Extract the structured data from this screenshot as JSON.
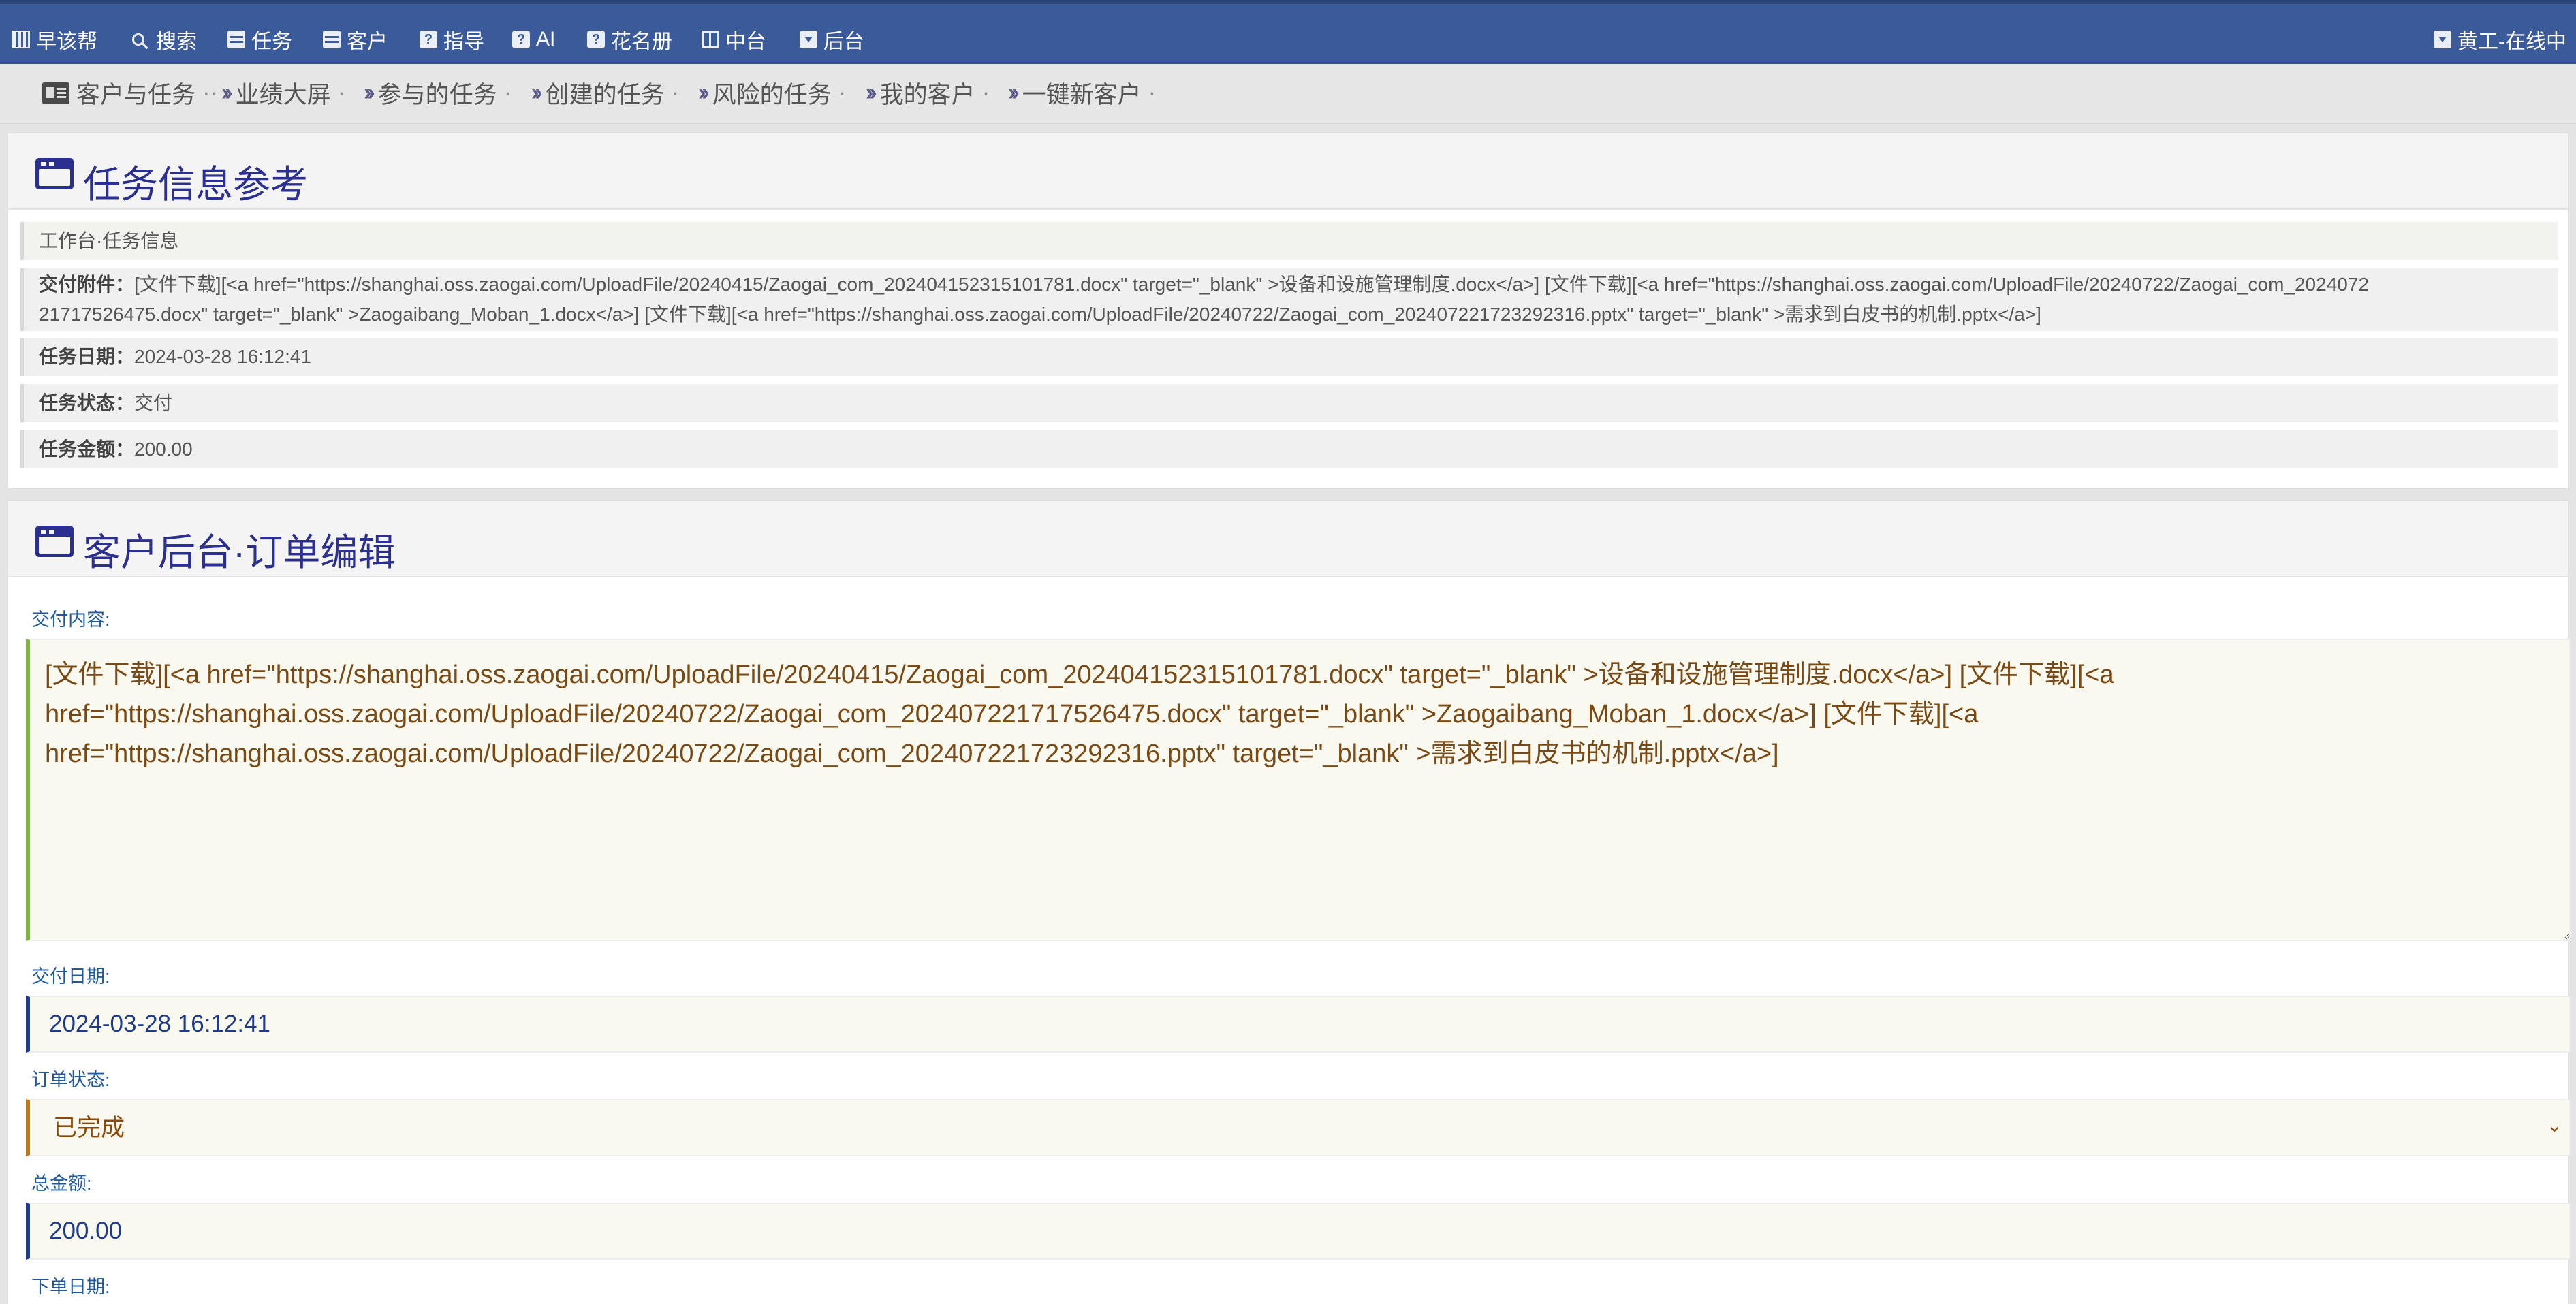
{
  "nav": {
    "items": [
      {
        "label": "早该帮",
        "icon": "barcode-icon"
      },
      {
        "label": "搜索",
        "icon": "search-icon"
      },
      {
        "label": "任务",
        "icon": "card-icon"
      },
      {
        "label": "客户",
        "icon": "card-icon"
      },
      {
        "label": "指导",
        "icon": "question-icon"
      },
      {
        "label": "AI",
        "icon": "question-icon"
      },
      {
        "label": "花名册",
        "icon": "question-icon"
      },
      {
        "label": "中台",
        "icon": "book-icon"
      },
      {
        "label": "后台",
        "icon": "dropdown-icon"
      }
    ],
    "user": "黄工-在线中"
  },
  "breadcrumb": {
    "home": "客户与任务",
    "home_sep": "··",
    "items": [
      {
        "label": "业绩大屏",
        "sep": "·"
      },
      {
        "label": "参与的任务",
        "sep": "·"
      },
      {
        "label": "创建的任务",
        "sep": "·"
      },
      {
        "label": "风险的任务",
        "sep": "·"
      },
      {
        "label": "我的客户",
        "sep": "·"
      },
      {
        "label": "一键新客户",
        "sep": "·"
      }
    ]
  },
  "task_info": {
    "title": "任务信息参考",
    "section": "工作台·任务信息",
    "attachments_label": "交付附件：",
    "attachments_line1": "[文件下载][<a href=\"https://shanghai.oss.zaogai.com/UploadFile/20240415/Zaogai_com_202404152315101781.docx\" target=\"_blank\" >设备和设施管理制度.docx</a>] [文件下载][<a href=\"https://shanghai.oss.zaogai.com/UploadFile/20240722/Zaogai_com_2024072",
    "attachments_line2": "21717526475.docx\" target=\"_blank\" >Zaogaibang_Moban_1.docx</a>] [文件下载][<a href=\"https://shanghai.oss.zaogai.com/UploadFile/20240722/Zaogai_com_202407221723292316.pptx\" target=\"_blank\" >需求到白皮书的机制.pptx</a>]",
    "date_label": "任务日期：",
    "date_value": "2024-03-28 16:12:41",
    "status_label": "任务状态：",
    "status_value": "交付",
    "amount_label": "任务金额：",
    "amount_value": "200.00"
  },
  "order_edit": {
    "title": "客户后台·订单编辑",
    "content_label": "交付内容:",
    "content_value": "[文件下载][<a href=\"https://shanghai.oss.zaogai.com/UploadFile/20240415/Zaogai_com_202404152315101781.docx\" target=\"_blank\" >设备和设施管理制度.docx</a>] [文件下载][<a href=\"https://shanghai.oss.zaogai.com/UploadFile/20240722/Zaogai_com_202407221717526475.docx\" target=\"_blank\" >Zaogaibang_Moban_1.docx</a>] [文件下载][<a href=\"https://shanghai.oss.zaogai.com/UploadFile/20240722/Zaogai_com_202407221723292316.pptx\" target=\"_blank\" >需求到白皮书的机制.pptx</a>]",
    "date_label": "交付日期:",
    "date_value": "2024-03-28 16:12:41",
    "status_label": "订单状态:",
    "status_value": "已完成",
    "total_label": "总金额:",
    "total_value": "200.00",
    "order_date_label": "下单日期:"
  },
  "colors": {
    "nav_bg": "#3b5a99",
    "title": "#2b2f8f",
    "label": "#1f5a9c",
    "content_border": "#7cb342",
    "status_border": "#c0761a"
  }
}
